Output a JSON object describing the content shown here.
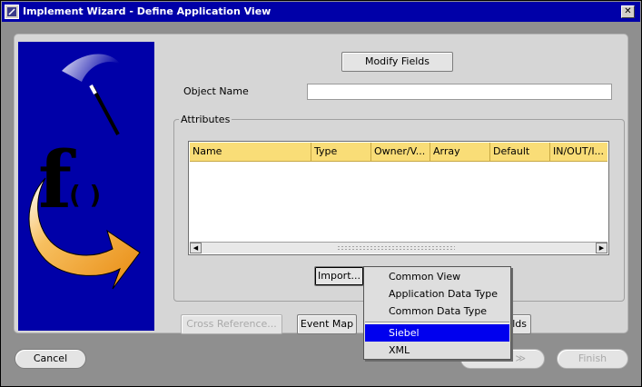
{
  "window": {
    "title": "Implement Wizard - Define Application View",
    "close_glyph": "✕"
  },
  "buttons": {
    "modify_fields": "Modify Fields",
    "import": "Import...",
    "cross_reference": "Cross Reference...",
    "event_map": "Event Map",
    "fields_partial": "lds",
    "cancel": "Cancel",
    "next": "≫",
    "finish": "Finish"
  },
  "form": {
    "object_name_label": "Object Name",
    "object_name_value": ""
  },
  "attributes": {
    "group_title": "Attributes",
    "columns": [
      "Name",
      "Type",
      "Owner/V...",
      "Array",
      "Default",
      "IN/OUT/I..."
    ],
    "rows": []
  },
  "scrollbar": {
    "left_arrow": "◀",
    "right_arrow": "▶"
  },
  "brand": {
    "letter": "f",
    "parens": "( )"
  },
  "import_menu": {
    "items": [
      "Common View",
      "Application Data Type",
      "Common Data Type",
      "Siebel",
      "XML"
    ],
    "selected": "Siebel"
  },
  "colors": {
    "titlebar": "#0000a8",
    "table_header": "#f9dd77",
    "menu_selection": "#0000ee",
    "brand_background": "#0000a8",
    "arrow_orange": "#f4a020"
  }
}
